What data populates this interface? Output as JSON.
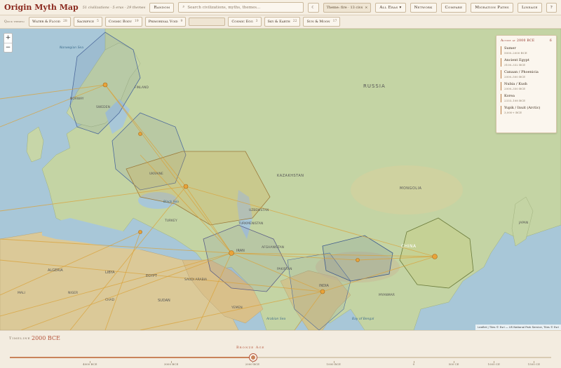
{
  "header": {
    "title": "Origin Myth Map",
    "subtitle": "51 civilizations · 5 eras · 29 themes",
    "random_label": "Random",
    "search_placeholder": "Search civilizations, myths, themes…",
    "moon_icon": "☾",
    "filter_chip": "Theme: fire · 13 civs",
    "filter_close": "×",
    "eras_label": "All Eras ▾",
    "network_label": "Network",
    "compare_label": "Compare",
    "migration_label": "Migration Paths",
    "lineage_label": "Lineage",
    "help_label": "?"
  },
  "quick_themes": {
    "label": "Quick themes:",
    "items": [
      {
        "label": "Water & Flood",
        "count": "28"
      },
      {
        "label": "Sacrifice",
        "count": "5"
      },
      {
        "label": "Cosmic Body",
        "count": "19"
      },
      {
        "label": "Primordial Void",
        "count": "9"
      },
      {
        "label": "Cosmic Egg",
        "count": "3"
      },
      {
        "label": "Sky & Earth",
        "count": "22"
      },
      {
        "label": "Sun & Moon",
        "count": "17"
      }
    ]
  },
  "map": {
    "zoom_in": "+",
    "zoom_out": "−",
    "attribution": "Leaflet | Tiles © Esri — US National Park Service, Tiles © Esri",
    "labels": {
      "russia": "RUSSIA",
      "kazakhstan": "KAZAKHSTAN",
      "mongolia": "MONGOLIA",
      "china": "CHINA",
      "india": "INDIA",
      "iran": "IRAN",
      "egypt": "EGYPT",
      "algeria": "ALGERIA",
      "libya": "LIBYA",
      "saudi": "SAUDI ARABIA",
      "sudan": "SUDAN",
      "finland": "FINLAND",
      "norway": "NORWAY",
      "sweden": "SWEDEN",
      "ukraine": "UKRAINE",
      "turkey": "TURKEY",
      "afghanistan": "AFGHANISTAN",
      "pakistan": "PAKISTAN",
      "turkmenistan": "TURKMENISTAN",
      "uzbekistan": "UZBEKISTAN",
      "norwegian_sea": "Norwegian Sea",
      "black_sea": "Black Sea",
      "arabian_sea": "Arabian Sea",
      "bay_bengal": "Bay of Bengal",
      "japan": "JAPAN",
      "mali": "MALI",
      "niger": "NIGER",
      "chad": "CHAD",
      "yemen": "YEMEN",
      "myanmar": "MYANMAR"
    }
  },
  "active_panel": {
    "title": "Active at 2000 BCE",
    "count": "6",
    "items": [
      {
        "name": "Sumer",
        "dates": "5000–2000 BCE"
      },
      {
        "name": "Ancient Egypt",
        "dates": "3100–332 BCE"
      },
      {
        "name": "Canaan / Phoenicia",
        "dates": "2000–500 BCE"
      },
      {
        "name": "Nubia / Kush",
        "dates": "2000–350 BCE"
      },
      {
        "name": "Korea",
        "dates": "2333–108 BCE"
      },
      {
        "name": "Yupik / Inuit (Arctic)",
        "dates": "3,000+ BCE"
      }
    ]
  },
  "timeline": {
    "label": "Timeline",
    "value": "2000 BCE",
    "value_fraction": 0.45,
    "era": "Bronze Age",
    "ticks": [
      {
        "label": "4000 BCE",
        "f": 0.148
      },
      {
        "label": "3000 BCE",
        "f": 0.298
      },
      {
        "label": "2000 BCE",
        "f": 0.448
      },
      {
        "label": "1000 BCE",
        "f": 0.598
      },
      {
        "label": "0",
        "f": 0.746
      },
      {
        "label": "500 CE",
        "f": 0.82
      },
      {
        "label": "1000 CE",
        "f": 0.894
      },
      {
        "label": "1500 CE",
        "f": 0.968
      }
    ]
  },
  "colors": {
    "accent": "#8b2a1f",
    "timeline": "#c9835a",
    "route": "#d9a23a"
  }
}
